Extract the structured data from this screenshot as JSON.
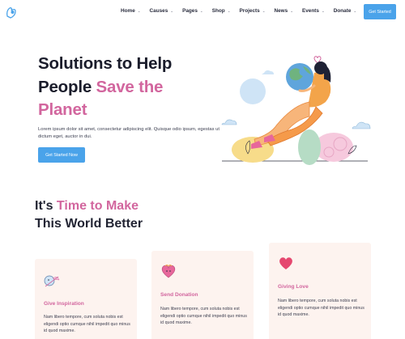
{
  "nav": {
    "items": [
      {
        "label": "Home"
      },
      {
        "label": "Causes"
      },
      {
        "label": "Pages"
      },
      {
        "label": "Shop"
      },
      {
        "label": "Projects"
      },
      {
        "label": "News"
      },
      {
        "label": "Events"
      },
      {
        "label": "Donate"
      }
    ],
    "cta_label": "Get Started"
  },
  "hero": {
    "title_line1": "Solutions to Help",
    "title_line2_plain": "People ",
    "title_line2_accent": "Save the",
    "title_line3_accent": "Planet",
    "text": "Lorem ipsum dolor sit amet, consectetur adipiscing elit. Quisque odio ipsum, egestas ut dictum eget, auctor in dui.",
    "cta_label": "Get Started Now"
  },
  "section": {
    "title_plain1": "It's ",
    "title_accent": "Time to Make",
    "title_line2": "This World Better"
  },
  "cards": [
    {
      "icon": "cupid-icon",
      "title": "Give Inspiration",
      "text": "Nam libero tempore, cum soluta nobis est eligendi optio cumque nihil impedit quo minus id quod maxime."
    },
    {
      "icon": "heart-gift-icon",
      "title": "Send Donation",
      "text": "Nam libero tempore, cum soluta nobis est eligendi optio cumque nihil impedit quo minus id quod maxime."
    },
    {
      "icon": "heart-icon",
      "title": "Giving Love",
      "text": "Nam libero tempore, cum soluta nobis est eligendi optio cumque nihil impedit quo minus id quod maxime."
    }
  ],
  "colors": {
    "accent": "#d2669e",
    "button": "#4aa3ea",
    "card_bg": "#fdf3ef",
    "heading": "#1a1c2b"
  }
}
